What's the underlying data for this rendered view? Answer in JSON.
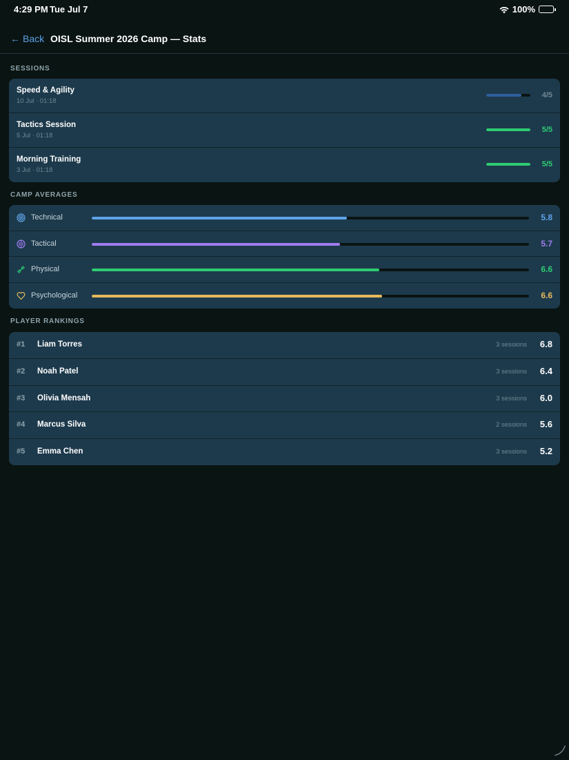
{
  "status_bar": {
    "time": "4:29 PM",
    "date": "Tue Jul 7",
    "battery": "100%"
  },
  "nav": {
    "back_label": "Back",
    "title": "OISL Summer 2026 Camp — Stats"
  },
  "sessions": {
    "header": "SESSIONS",
    "items": [
      {
        "name": "Speed & Agility",
        "date": "10 Jul · 01:18",
        "count": "4/5",
        "progress": 0.8,
        "color": "#2e5f9e",
        "count_color": "#6f8794"
      },
      {
        "name": "Tactics Session",
        "date": "5 Jul · 01:18",
        "count": "5/5",
        "progress": 1.0,
        "color": "#2ecc71",
        "count_color": "#2ecc71"
      },
      {
        "name": "Morning Training",
        "date": "3 Jul · 01:18",
        "count": "5/5",
        "progress": 1.0,
        "color": "#2ecc71",
        "count_color": "#2ecc71"
      }
    ]
  },
  "averages": {
    "header": "CAMP AVERAGES",
    "items": [
      {
        "label": "Technical",
        "icon": "target-icon",
        "value": "5.8",
        "fraction": 0.584,
        "color": "#5fa3e8"
      },
      {
        "label": "Tactical",
        "icon": "brain-icon",
        "value": "5.7",
        "fraction": 0.568,
        "color": "#a07cf0"
      },
      {
        "label": "Physical",
        "icon": "dumbbell-icon",
        "value": "6.6",
        "fraction": 0.657,
        "color": "#2ecc71"
      },
      {
        "label": "Psychological",
        "icon": "heart-icon",
        "value": "6.6",
        "fraction": 0.664,
        "color": "#e6b95a"
      }
    ]
  },
  "rankings": {
    "header": "PLAYER RANKINGS",
    "items": [
      {
        "rank": "#1",
        "name": "Liam Torres",
        "sessions": "3 sessions",
        "score": "6.8"
      },
      {
        "rank": "#2",
        "name": "Noah Patel",
        "sessions": "3 sessions",
        "score": "6.4"
      },
      {
        "rank": "#3",
        "name": "Olivia Mensah",
        "sessions": "3 sessions",
        "score": "6.0"
      },
      {
        "rank": "#4",
        "name": "Marcus Silva",
        "sessions": "2 sessions",
        "score": "5.6"
      },
      {
        "rank": "#5",
        "name": "Emma Chen",
        "sessions": "3 sessions",
        "score": "5.2"
      }
    ]
  }
}
